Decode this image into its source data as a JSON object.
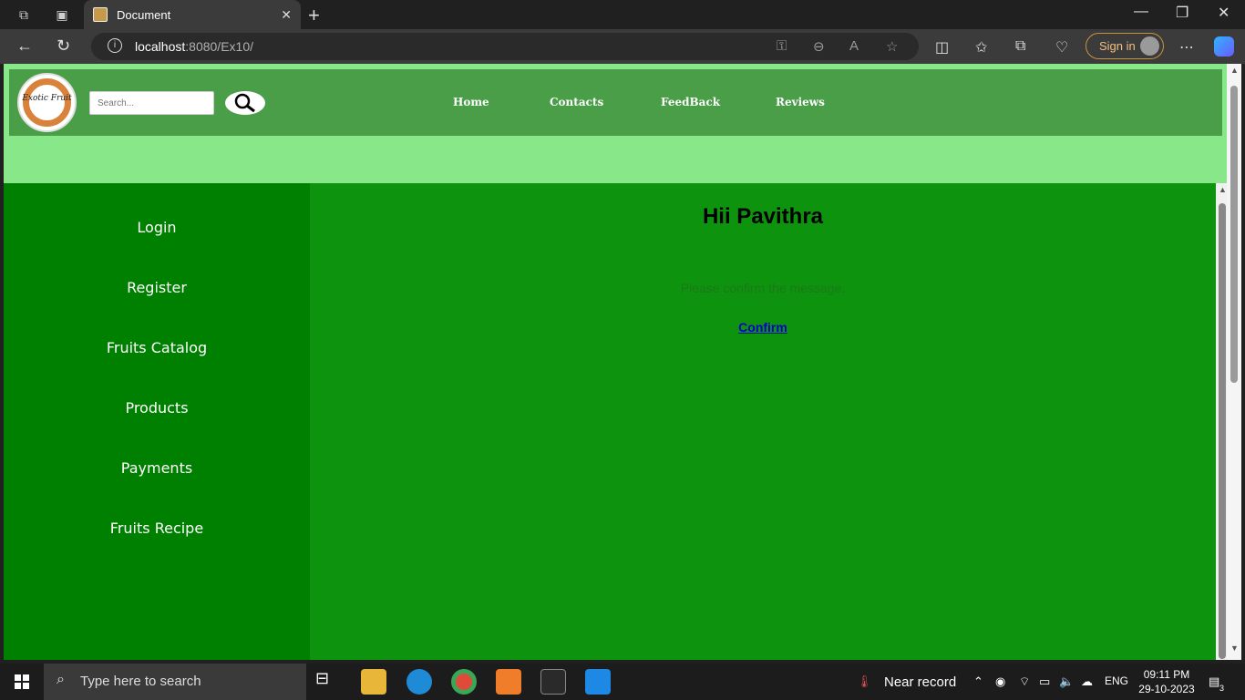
{
  "browser": {
    "tab_title": "Document",
    "url_host": "localhost",
    "url_path": ":8080/Ex10/",
    "signin_label": "Sign in"
  },
  "page": {
    "logo_text": "Exotic Fruit",
    "search_placeholder": "Search...",
    "topnav": [
      "Home",
      "Contacts",
      "FeedBack",
      "Reviews"
    ],
    "sidebar": [
      "Login",
      "Register",
      "Fruits Catalog",
      "Products",
      "Payments",
      "Fruits Recipe"
    ],
    "greeting": "Hii Pavithra",
    "message": "Please confirm the message.",
    "confirm_label": "Confirm"
  },
  "taskbar": {
    "search_placeholder": "Type here to search",
    "weather": "Near record",
    "language": "ENG",
    "time": "09:11 PM",
    "date": "29-10-2023",
    "notifications": "3"
  },
  "colors": {
    "header_green": "#4a9e48",
    "band_green": "#88e788",
    "sidebar_green": "#008000",
    "main_green": "#0e930e"
  }
}
